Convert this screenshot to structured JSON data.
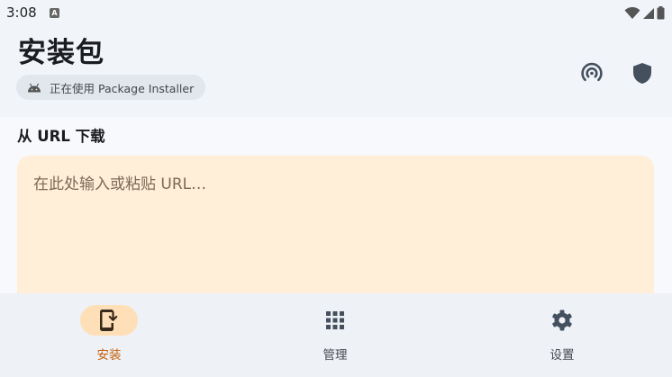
{
  "status_bar": {
    "time": "3:08",
    "notification_badge": "A",
    "icons": [
      "wifi-icon",
      "cell-signal-icon",
      "battery-icon"
    ]
  },
  "header": {
    "title": "安装包",
    "installer_chip": {
      "icon": "android-icon",
      "label": "正在使用 Package Installer"
    },
    "actions": [
      {
        "icon": "broadcast-icon"
      },
      {
        "icon": "shield-icon"
      }
    ]
  },
  "main": {
    "section_title": "从 URL 下载",
    "url_input": {
      "value": "",
      "placeholder": "在此处输入或粘贴 URL…"
    }
  },
  "bottom_nav": {
    "items": [
      {
        "label": "安装",
        "icon": "install-phone-icon",
        "active": true
      },
      {
        "label": "管理",
        "icon": "grid-icon",
        "active": false
      },
      {
        "label": "设置",
        "icon": "gear-icon",
        "active": false
      }
    ]
  },
  "colors": {
    "accent": "#c6610f",
    "active_pill": "#ffdfb8",
    "url_box": "#ffeed8",
    "background": "#f1f4f9"
  }
}
